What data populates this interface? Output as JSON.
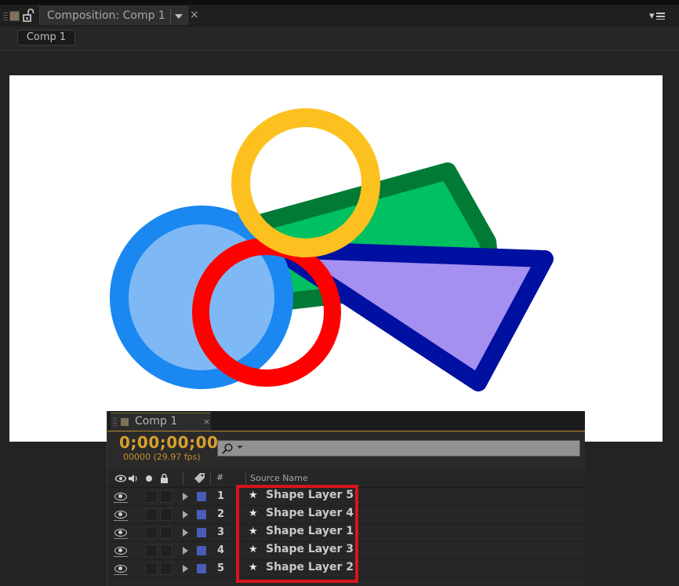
{
  "composition_panel": {
    "tab_title": "Composition: Comp 1",
    "breadcrumb": "Comp 1",
    "close_glyph": "×",
    "panel_menu_glyph": "▾"
  },
  "canvas_shapes": {
    "background": "#ffffff",
    "colors": {
      "green_fill": "#00c062",
      "green_stroke": "#007a35",
      "purple_fill": "#a58ff0",
      "purple_stroke": "#0010a0",
      "blue_fill": "#7fb9f5",
      "blue_stroke": "#1a88f0",
      "red_stroke": "#ff0000",
      "yellow_stroke": "#fcc11e"
    }
  },
  "timeline_panel": {
    "tab_title": "Comp 1",
    "close_glyph": "×",
    "timecode": "0;00;00;00",
    "frame_info": "00000 (29.97 fps)",
    "header": {
      "number": "#",
      "source_name": "Source Name"
    },
    "label_color": "#4b5bb8",
    "layers": [
      {
        "number": "1",
        "name": "Shape Layer 5"
      },
      {
        "number": "2",
        "name": "Shape Layer 4"
      },
      {
        "number": "3",
        "name": "Shape Layer 1"
      },
      {
        "number": "4",
        "name": "Shape Layer 3"
      },
      {
        "number": "5",
        "name": "Shape Layer 2"
      }
    ],
    "highlight_color": "#d9141e"
  }
}
